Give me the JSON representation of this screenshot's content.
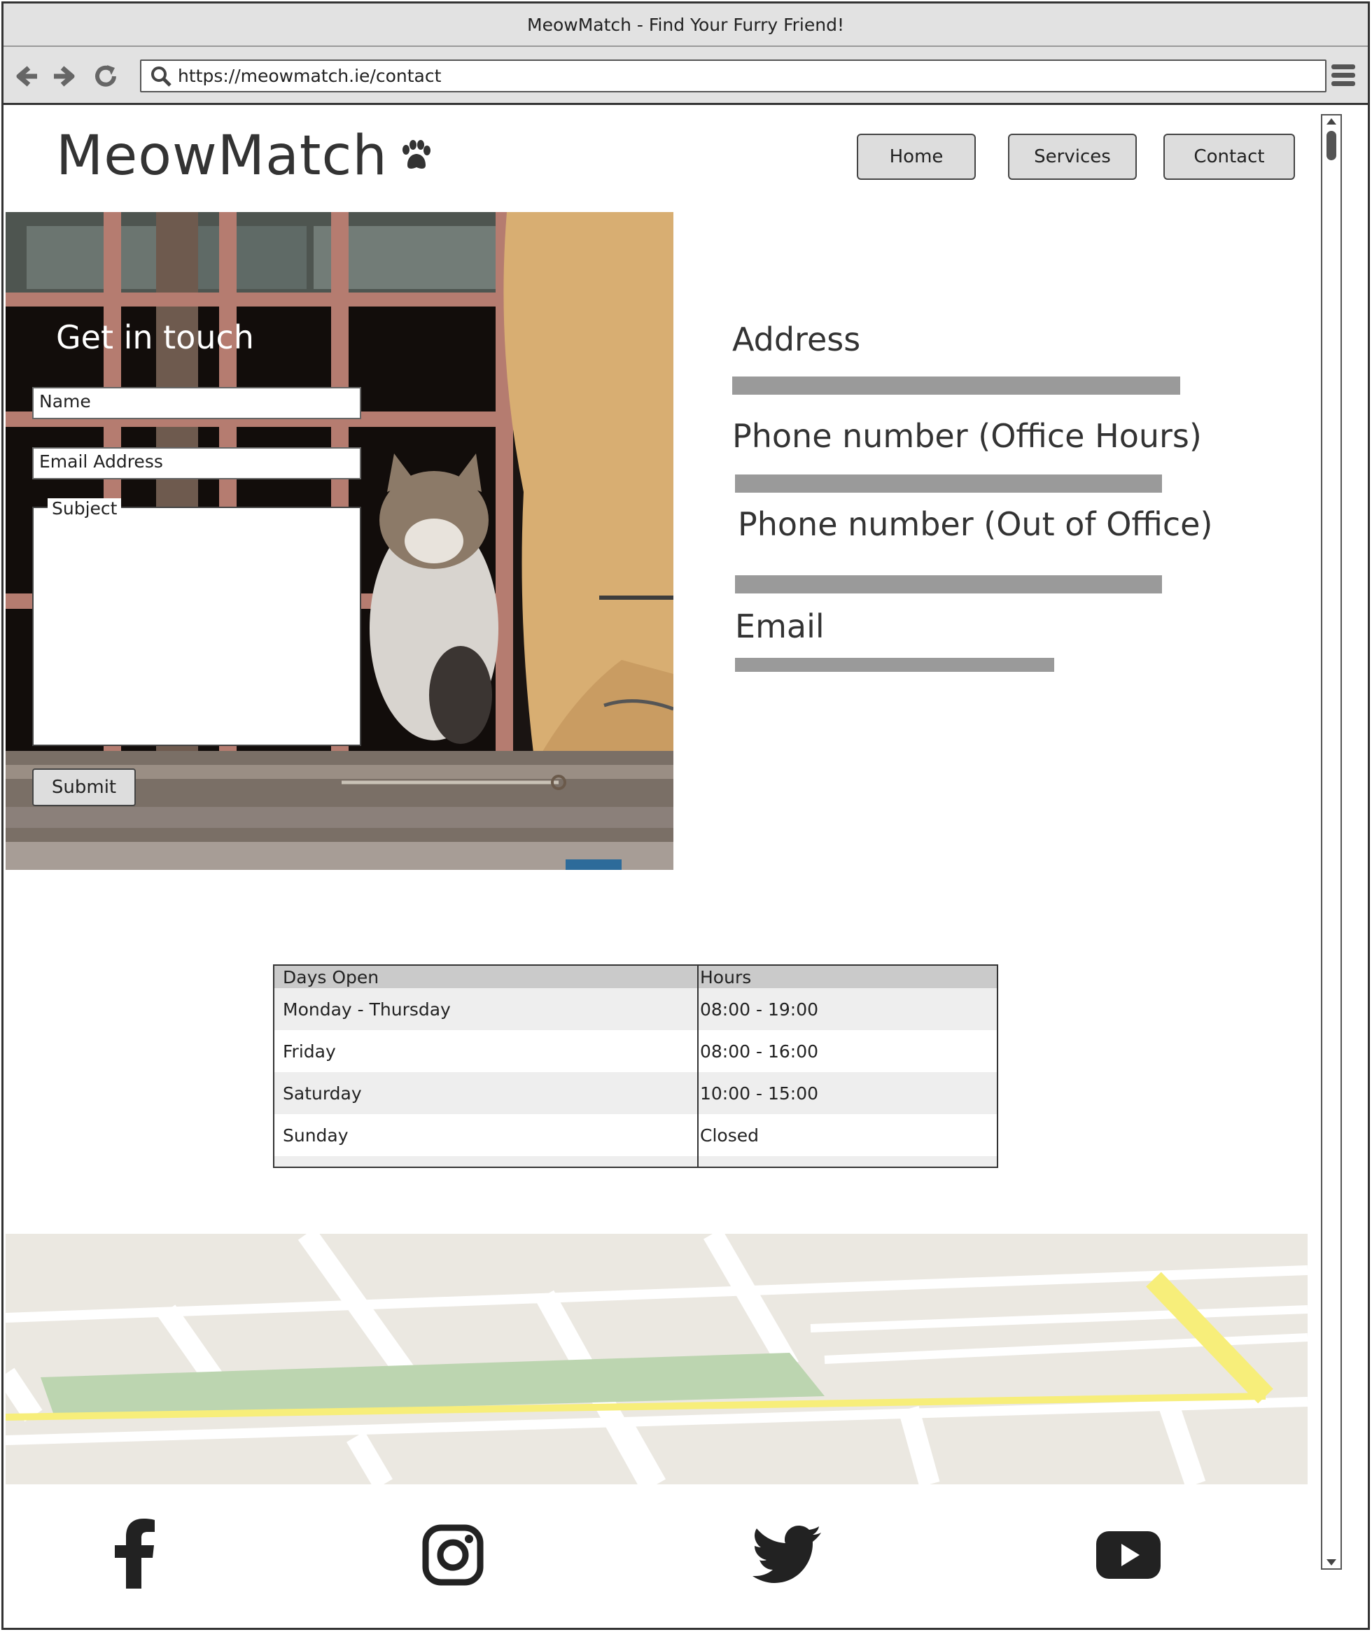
{
  "window": {
    "title": "MeowMatch - Find Your Furry Friend!"
  },
  "browser": {
    "url": "https://meowmatch.ie/contact"
  },
  "header": {
    "logo_text": "MeowMatch",
    "nav": [
      {
        "label": "Home"
      },
      {
        "label": "Services"
      },
      {
        "label": "Contact"
      }
    ]
  },
  "form": {
    "heading": "Get in touch",
    "name_placeholder": "Name",
    "email_placeholder": "Email Address",
    "subject_label": "Subject",
    "submit_label": "Submit"
  },
  "contact_info": {
    "address_label": "Address",
    "phone_office_label": "Phone number (Office Hours)",
    "phone_out_label": "Phone number (Out of Office)",
    "email_label": "Email"
  },
  "hours_table": {
    "headers": [
      "Days Open",
      "Hours"
    ],
    "rows": [
      [
        "Monday - Thursday",
        "08:00 - 19:00"
      ],
      [
        "Friday",
        "08:00 - 16:00"
      ],
      [
        "Saturday",
        "10:00 - 15:00"
      ],
      [
        "Sunday",
        "Closed"
      ]
    ]
  },
  "footer": {
    "social_icons": [
      "facebook-icon",
      "instagram-icon",
      "twitter-icon",
      "youtube-icon"
    ]
  },
  "colors": {
    "placeholder_bar": "#9a9a9a",
    "map_road_yellow": "#f7ee7a",
    "map_park_green": "#bcd5b0",
    "map_base": "#ebe8e1"
  }
}
